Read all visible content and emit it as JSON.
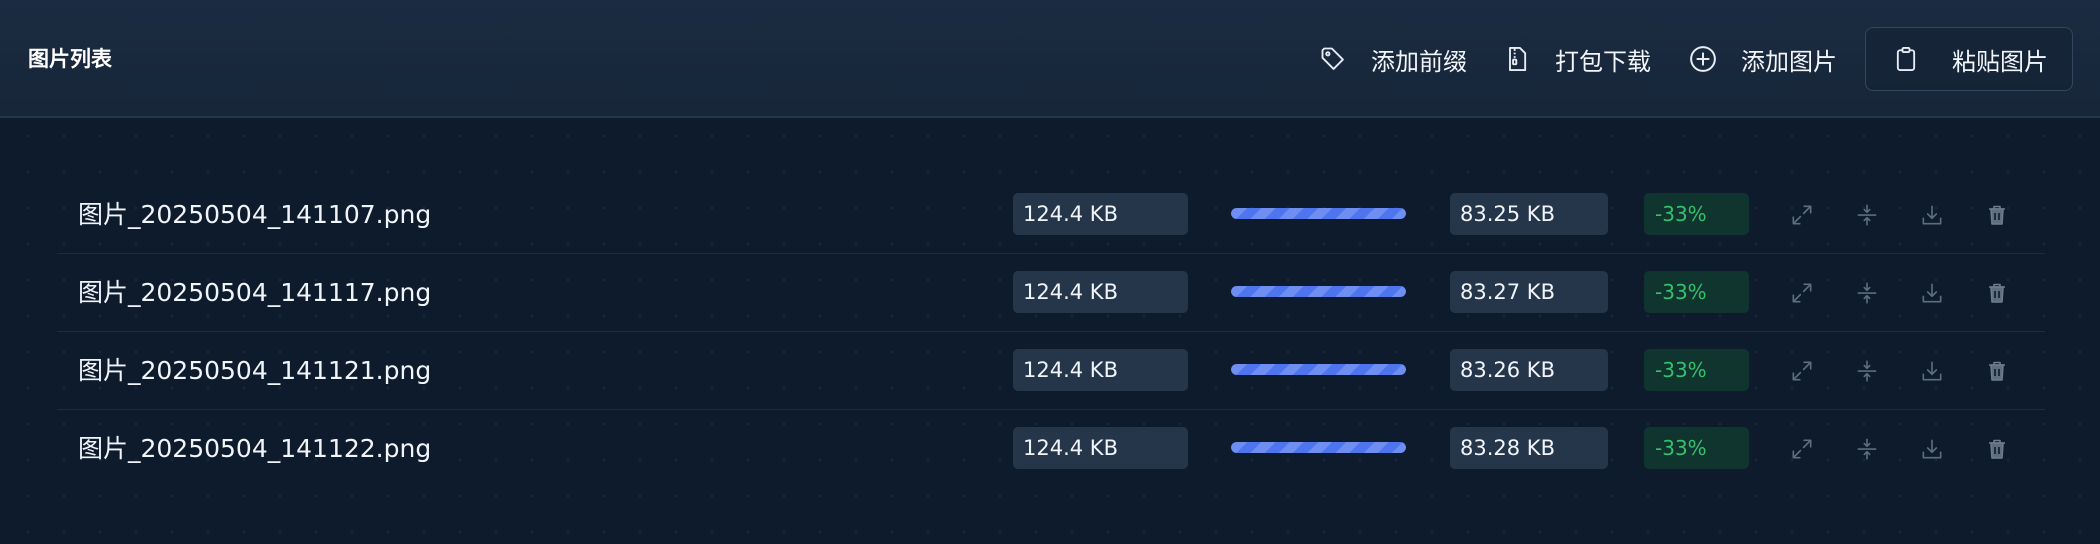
{
  "header": {
    "title": "图片列表",
    "actions": {
      "add_prefix": "添加前缀",
      "pack_download": "打包下载",
      "add_image": "添加图片",
      "paste_image": "粘贴图片"
    }
  },
  "files": [
    {
      "name": "图片_20250504_141107.png",
      "original_size": "124.4 KB",
      "compressed_size": "83.25 KB",
      "change": "-33%",
      "progress_percent": 100
    },
    {
      "name": "图片_20250504_141117.png",
      "original_size": "124.4 KB",
      "compressed_size": "83.27 KB",
      "change": "-33%",
      "progress_percent": 100
    },
    {
      "name": "图片_20250504_141121.png",
      "original_size": "124.4 KB",
      "compressed_size": "83.26 KB",
      "change": "-33%",
      "progress_percent": 100
    },
    {
      "name": "图片_20250504_141122.png",
      "original_size": "124.4 KB",
      "compressed_size": "83.28 KB",
      "change": "-33%",
      "progress_percent": 100
    }
  ],
  "icons": {
    "add_prefix": "tag-icon",
    "pack_download": "zip-file-icon",
    "add_image": "plus-circle-icon",
    "paste_image": "clipboard-icon",
    "row_actions": [
      "expand-icon",
      "compress-icon",
      "download-icon",
      "trash-icon"
    ]
  },
  "colors": {
    "background": "#0d1b2d",
    "header": "#1a2a3f",
    "accent": "#4f75ee",
    "success": "#35c06a",
    "success_bg": "#10352f",
    "size_box": "#25364b"
  }
}
